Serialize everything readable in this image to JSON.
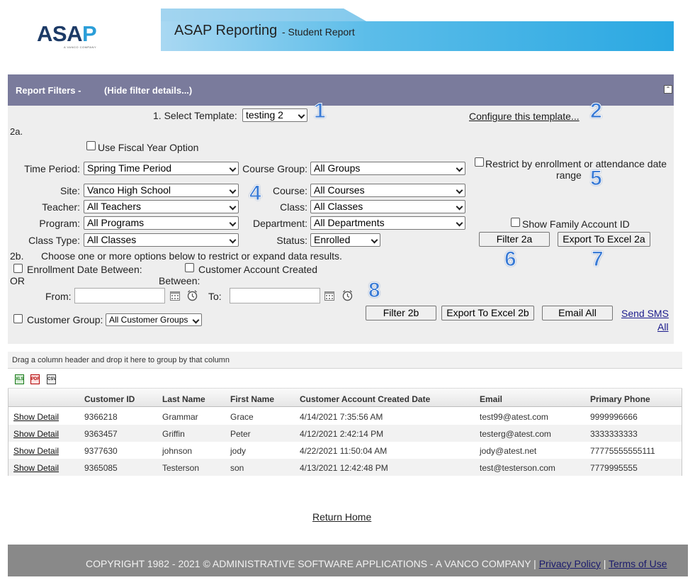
{
  "header": {
    "logo_main": "ASA",
    "logo_p": "P",
    "logo_tag": "A VANCO COMPANY",
    "title": "ASAP Reporting",
    "subtitle": "- Student Report"
  },
  "filters": {
    "bar_title": "Report Filters -",
    "hide_link": "(Hide filter details...)",
    "template_label": "1.  Select Template:",
    "template_value": "testing 2",
    "configure_link": "Configure this template...",
    "section_2a": "2a.",
    "fiscal_year_label": "Use Fiscal Year Option",
    "time_period_label": "Time Period:",
    "time_period_value": "Spring Time Period",
    "course_group_label": "Course Group:",
    "course_group_value": "All Groups",
    "restrict_label_1": "Restrict by enrollment or attendance date",
    "restrict_label_2": "range",
    "site_label": "Site:",
    "site_value": "Vanco High School",
    "course_label": "Course:",
    "course_value": "All Courses",
    "teacher_label": "Teacher:",
    "teacher_value": "All Teachers",
    "class_label": "Class:",
    "class_value": "All Classes",
    "program_label": "Program:",
    "program_value": "All Programs",
    "department_label": "Department:",
    "department_value": "All Departments",
    "show_family_label": "Show Family Account ID",
    "class_type_label": "Class Type:",
    "class_type_value": "All Classes",
    "status_label": "Status:",
    "status_value": "Enrolled",
    "filter_2a": "Filter 2a",
    "export_2a": "Export To Excel 2a",
    "section_2b": "2b.",
    "section_2b_text": "Choose one or more options below to restrict or expand data results.",
    "enroll_date_label": "Enrollment Date Between:",
    "or_label": "OR",
    "cust_created_label": "Customer Account Created",
    "between_label": "Between:",
    "from_label": "From:",
    "to_label": "To:",
    "customer_group_label": "Customer Group:",
    "customer_group_value": "All Customer Groups",
    "filter_2b": "Filter 2b",
    "export_2b": "Export To Excel 2b",
    "email_all": "Email All",
    "send_sms_1": "Send SMS",
    "send_sms_2": "All"
  },
  "callouts": [
    "1",
    "2",
    "4",
    "5",
    "6",
    "7",
    "8"
  ],
  "grid": {
    "group_hint": "Drag a column header and drop it here to group by that column",
    "export_icons": [
      "XLS",
      "PDF",
      "CSV"
    ],
    "columns": [
      "Customer ID",
      "Last Name",
      "First Name",
      "Customer Account Created Date",
      "Email",
      "Primary Phone"
    ],
    "rows": [
      {
        "action": "Show Detail",
        "id": "9366218",
        "last": "Grammar",
        "first": "Grace",
        "created": "4/14/2021 7:35:56 AM",
        "email": "test99@atest.com",
        "phone": "9999996666"
      },
      {
        "action": "Show Detail",
        "id": "9363457",
        "last": "Griffin",
        "first": "Peter",
        "created": "4/12/2021 2:42:14 PM",
        "email": "testerg@atest.com",
        "phone": "3333333333"
      },
      {
        "action": "Show Detail",
        "id": "9377630",
        "last": "johnson",
        "first": "jody",
        "created": "4/22/2021 11:50:04 AM",
        "email": "jody@atest.net",
        "phone": "77775555555111"
      },
      {
        "action": "Show Detail",
        "id": "9365085",
        "last": "Testerson",
        "first": "son",
        "created": "4/13/2021 12:42:48 PM",
        "email": "test@testerson.com",
        "phone": "7779995555"
      }
    ]
  },
  "return_home": "Return Home",
  "footer": {
    "copyright": "COPYRIGHT 1982 - 2021 © ADMINISTRATIVE SOFTWARE APPLICATIONS - A VANCO COMPANY |",
    "privacy": "Privacy Policy",
    "sep": "|",
    "terms": "Terms of Use"
  },
  "colors": {
    "filter_bar": "#7a7b9c",
    "banner_start": "#a9d8f2",
    "banner_end": "#2aa8e2",
    "callout": "#3a7bd5"
  }
}
